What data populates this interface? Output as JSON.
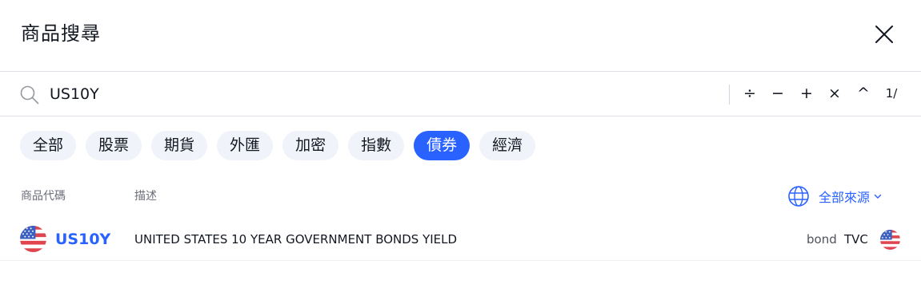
{
  "header": {
    "title": "商品搜尋"
  },
  "search": {
    "value": "US10Y",
    "operators": [
      "÷",
      "−",
      "+",
      "×",
      "^",
      "1/"
    ]
  },
  "filters": [
    "全部",
    "股票",
    "期貨",
    "外匯",
    "加密",
    "指數",
    "債券",
    "經濟"
  ],
  "active_filter": "債券",
  "columns": {
    "symbol": "商品代碼",
    "description": "描述"
  },
  "source_filter": {
    "label": "全部來源"
  },
  "results": [
    {
      "symbol": "US10Y",
      "description": "UNITED STATES 10 YEAR GOVERNMENT BONDS YIELD",
      "type": "bond",
      "exchange": "TVC",
      "flag": "us-flag-icon"
    }
  ],
  "colors": {
    "accent": "#2962ff",
    "chip_bg": "#f0f3fa",
    "text": "#131722",
    "muted": "#6a6d78"
  }
}
